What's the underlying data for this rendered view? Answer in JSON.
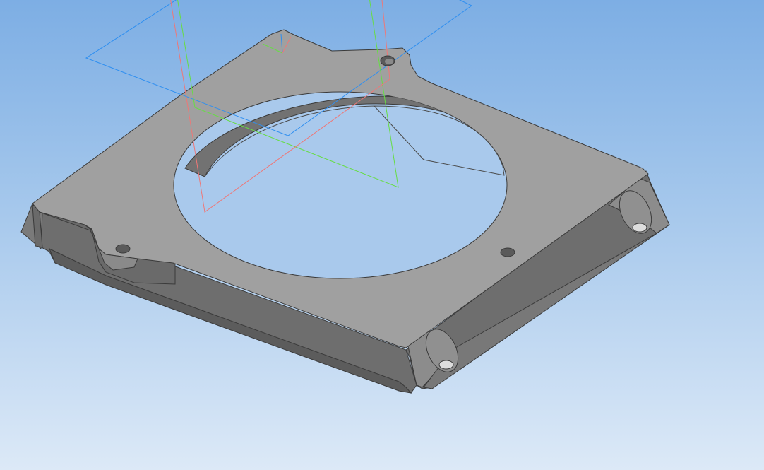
{
  "viewport": {
    "background_top": "#7daee4",
    "background_bottom": "#dce9f7"
  },
  "model": {
    "face_color": "#a0a0a0",
    "side_color": "#6e6e6e",
    "dark_side_color": "#5c5c5c",
    "edge_color": "#3a3a3a",
    "hole_color": "#8a8a8a"
  },
  "planes": {
    "xy_color": "#2f8ff0",
    "zy_color": "#66dd44",
    "zx_color": "#ee7777"
  },
  "icons": {
    "origin": "axis-origin-icon"
  }
}
